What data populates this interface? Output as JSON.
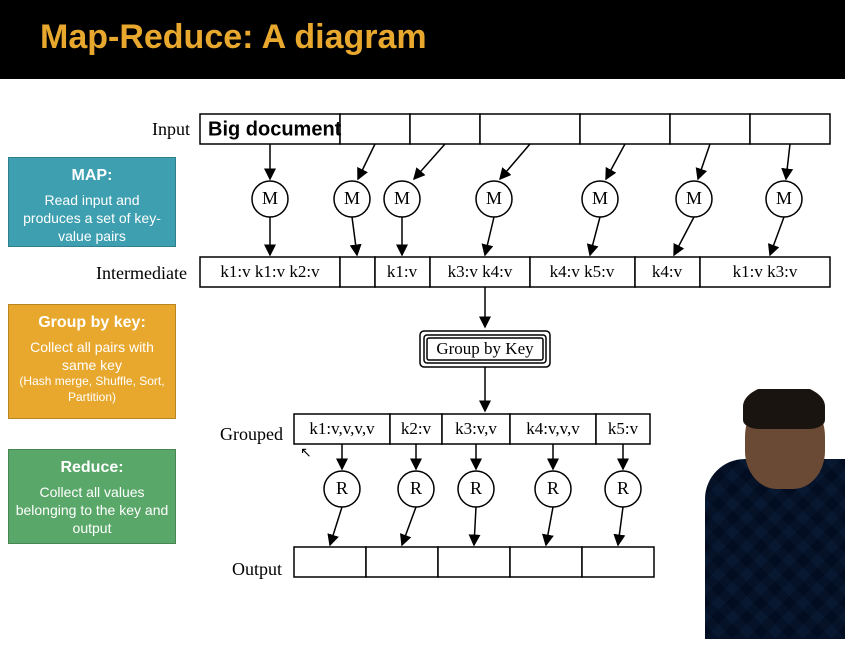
{
  "title": "Map-Reduce: A diagram",
  "labels": {
    "input": "Input",
    "intermediate": "Intermediate",
    "grouped": "Grouped",
    "output": "Output",
    "big_doc": "Big document",
    "group_by_key": "Group by Key"
  },
  "side": {
    "map": {
      "hdr": "MAP:",
      "body": "Read input and produces a set of key-value pairs"
    },
    "group": {
      "hdr": "Group by key:",
      "body": "Collect all pairs with same key",
      "sub": "(Hash merge, Shuffle, Sort, Partition)"
    },
    "reduce": {
      "hdr": "Reduce:",
      "body": "Collect all values belonging to the key and output"
    }
  },
  "intermediate_cells": [
    "k1:v k1:v k2:v",
    "",
    "k1:v",
    "k3:v k4:v",
    "k4:v k5:v",
    "k4:v",
    "k1:v k3:v"
  ],
  "grouped_cells": [
    "k1:v,v,v,v",
    "k2:v",
    "k3:v,v",
    "k4:v,v,v",
    "k5:v"
  ],
  "nodes": {
    "M": "M",
    "R": "R"
  }
}
